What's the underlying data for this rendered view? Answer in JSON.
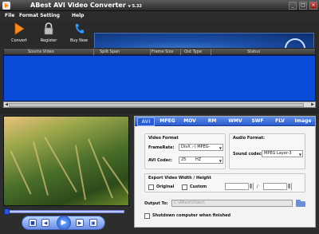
{
  "window": {
    "title": "ABest AVI Video Converter",
    "version": "v 5.32"
  },
  "menu": [
    "File",
    "Format Setting",
    "Help"
  ],
  "toolbar": {
    "convert": "Convert",
    "register": "Register",
    "buy": "Buy Now"
  },
  "list_columns": [
    "Source Video",
    "Split Span",
    "Frame Size",
    "Out Type",
    "Status"
  ],
  "tabs": [
    "AVI",
    "MPEG",
    "MOV",
    "RM",
    "WMV",
    "SWF",
    "FLV",
    "Image"
  ],
  "video_format": {
    "title": "Video Format",
    "framerate_label": "FrameRate:",
    "framerate_value": "DivX ;-) MPEG-",
    "codec_label": "AVI Codec:",
    "codec_value": "25",
    "codec_unit": "HZ"
  },
  "audio_format": {
    "title": "Audio Format:",
    "codec_label": "Sound codec:",
    "codec_value": "MPEG Layer-3"
  },
  "export": {
    "title": "Export Video Width / Height",
    "original": "Original",
    "custom": "Custom",
    "slash": "/"
  },
  "output": {
    "label": "Output To:",
    "path": "C:\\ABest\\Video\\"
  },
  "shutdown": "Shutdown computer when finished",
  "icons": {
    "convert": "play-arrow-icon",
    "register": "lock-icon",
    "buy": "phone-icon",
    "folder": "folder-icon"
  }
}
